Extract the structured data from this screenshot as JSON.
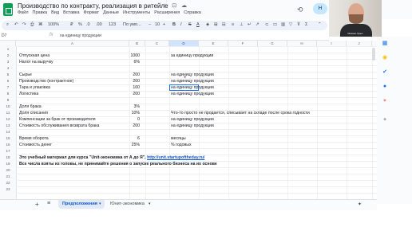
{
  "doc": {
    "title": "Производство по контракту, реализация в ритейле",
    "title_icons": "☆ ⊡ ☁"
  },
  "menu": [
    "Файл",
    "Правка",
    "Вид",
    "Вставка",
    "Формат",
    "Данные",
    "Инструменты",
    "Расширения",
    "Справка"
  ],
  "toolbar": {
    "zoom": "100%",
    "currency": "₽",
    "percent": "%",
    "decimals_dec": ".0",
    "decimals_inc": ".00",
    "number_format": "123",
    "font": "По умо...",
    "font_size": "10",
    "bold": "B",
    "italic": "I",
    "strike": "S",
    "color": "A"
  },
  "share": {
    "label": "Н"
  },
  "webcam": {
    "name": "Михаил Хрыч"
  },
  "formula_bar": {
    "cell_ref": "D7",
    "fx": "fx",
    "content": "на единицу продукции"
  },
  "columns": [
    "A",
    "B",
    "C",
    "D",
    "E",
    "F",
    "G",
    "H",
    "I",
    "J",
    "K"
  ],
  "rows": [
    "1",
    "2",
    "3",
    "4",
    "5",
    "6",
    "7",
    "8",
    "9",
    "10",
    "11",
    "12",
    "13",
    "14",
    "15",
    "16",
    "17",
    "18",
    "19",
    "20",
    "21",
    "22",
    "23"
  ],
  "cells": {
    "r2a": "Отпускная цена",
    "r2b": "1000",
    "r2d": "за единицу продукции",
    "r3a": "Налог на выручку",
    "r3b": "6%",
    "r5a": "Сырье",
    "r5b": "200",
    "r5d": "на единицу продукции",
    "r6a": "Производство (контрактное)",
    "r6b": "200",
    "r6d": "на единицу продукции",
    "r7a": "Тара и упаковка",
    "r7b": "100",
    "r7d": "на единицу продукции",
    "r8a": "Логистика",
    "r8b": "200",
    "r8d": "на единицу продукции",
    "r10a": "Доля брака",
    "r10b": "3%",
    "r11a": "Доля списания",
    "r11b": "10%",
    "r11d": "Что-то просто не продается, списывает на складе после срока годности",
    "r12a": "Компенсации за брак от производителя",
    "r12b": "0",
    "r12d": "на единицу продукции",
    "r13a": "Стоимость обслуживания возврата брака",
    "r13b": "200",
    "r13d": "на единицу продукции",
    "r15a": "Время оборота",
    "r15b": "6",
    "r15d": "месяцы",
    "r16a": "Стоимость денег",
    "r16b": "25%",
    "r16d": "% годовых",
    "r18a": "Это учебный материал для курса \"Unit-экономика от А до Я\",",
    "r18link": "http://unit.startupoftheday.ru/",
    "r19a": "Все числа взяты из головы, не принимайте решения о запуске реального бизнеса на их основе"
  },
  "sheets": {
    "add": "+",
    "all": "≡",
    "tab1": "Предположения",
    "tab2": "Юнит-экономика",
    "arrow": "▾"
  },
  "side_icons": [
    "calendar-icon",
    "keep-icon",
    "tasks-icon",
    "contacts-icon",
    "maps-icon",
    "add-icon"
  ],
  "colors": {
    "accent": "#1a73e8",
    "sheet_green": "#0f9d58"
  }
}
